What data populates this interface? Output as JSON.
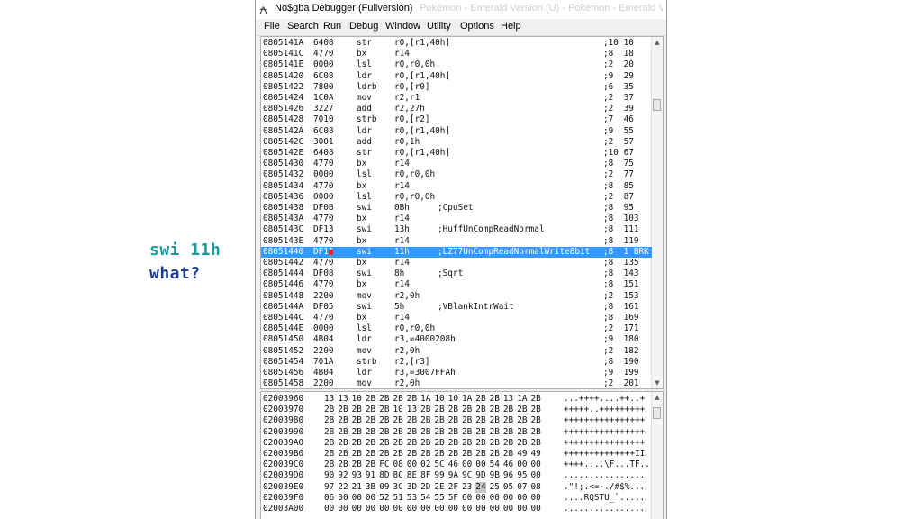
{
  "captions": {
    "line1": "swi 11h",
    "line2": "what?"
  },
  "window": {
    "title": "No$gba Debugger (Fullversion)",
    "ghost_title": "Pokémon - Emerald Version (U) - Pokémon - Emerald Version (U)",
    "app_icon": "nocash-icon"
  },
  "menu": [
    "File",
    "Search",
    "Run",
    "Debug",
    "Window",
    "Utility",
    "Options",
    "Help"
  ],
  "disasm_rows": [
    {
      "addr": "0805141A",
      "op": "6408",
      "mn": "str",
      "args": "r0,[r1,40h]",
      "cmt": "",
      "cyc": ";10 10"
    },
    {
      "addr": "0805141C",
      "op": "4770",
      "mn": "bx",
      "args": "r14",
      "cmt": "",
      "cyc": ";8  18"
    },
    {
      "addr": "0805141E",
      "op": "0000",
      "mn": "lsl",
      "args": "r0,r0,0h",
      "cmt": "",
      "cyc": ";2  20"
    },
    {
      "addr": "08051420",
      "op": "6C08",
      "mn": "ldr",
      "args": "r0,[r1,40h]",
      "cmt": "",
      "cyc": ";9  29"
    },
    {
      "addr": "08051422",
      "op": "7800",
      "mn": "ldrb",
      "args": "r0,[r0]",
      "cmt": "",
      "cyc": ";6  35"
    },
    {
      "addr": "08051424",
      "op": "1C0A",
      "mn": "mov",
      "args": "r2,r1",
      "cmt": "",
      "cyc": ";2  37"
    },
    {
      "addr": "08051426",
      "op": "3227",
      "mn": "add",
      "args": "r2,27h",
      "cmt": "",
      "cyc": ";2  39"
    },
    {
      "addr": "08051428",
      "op": "7010",
      "mn": "strb",
      "args": "r0,[r2]",
      "cmt": "",
      "cyc": ";7  46"
    },
    {
      "addr": "0805142A",
      "op": "6C08",
      "mn": "ldr",
      "args": "r0,[r1,40h]",
      "cmt": "",
      "cyc": ";9  55"
    },
    {
      "addr": "0805142C",
      "op": "3001",
      "mn": "add",
      "args": "r0,1h",
      "cmt": "",
      "cyc": ";2  57"
    },
    {
      "addr": "0805142E",
      "op": "6408",
      "mn": "str",
      "args": "r0,[r1,40h]",
      "cmt": "",
      "cyc": ";10 67"
    },
    {
      "addr": "08051430",
      "op": "4770",
      "mn": "bx",
      "args": "r14",
      "cmt": "",
      "cyc": ";8  75"
    },
    {
      "addr": "08051432",
      "op": "0000",
      "mn": "lsl",
      "args": "r0,r0,0h",
      "cmt": "",
      "cyc": ";2  77"
    },
    {
      "addr": "08051434",
      "op": "4770",
      "mn": "bx",
      "args": "r14",
      "cmt": "",
      "cyc": ";8  85"
    },
    {
      "addr": "08051436",
      "op": "0000",
      "mn": "lsl",
      "args": "r0,r0,0h",
      "cmt": "",
      "cyc": ";2  87"
    },
    {
      "addr": "08051438",
      "op": "DF0B",
      "mn": "swi",
      "args": "0Bh",
      "cmt": ";CpuSet",
      "cyc": ";8  95"
    },
    {
      "addr": "0805143A",
      "op": "4770",
      "mn": "bx",
      "args": "r14",
      "cmt": "",
      "cyc": ";8  103"
    },
    {
      "addr": "0805143C",
      "op": "DF13",
      "mn": "swi",
      "args": "13h",
      "cmt": ";HuffUnCompReadNormal",
      "cyc": ";8  111"
    },
    {
      "addr": "0805143E",
      "op": "4770",
      "mn": "bx",
      "args": "r14",
      "cmt": "",
      "cyc": ";8  119"
    },
    {
      "addr": "08051440",
      "op": "DF11",
      "mn": "swi",
      "args": "11h",
      "cmt": ";LZ77UnCompReadNormalWrite8bit",
      "cyc": ";8  1 BRK",
      "selected": true
    },
    {
      "addr": "08051442",
      "op": "4770",
      "mn": "bx",
      "args": "r14",
      "cmt": "",
      "cyc": ";8  135"
    },
    {
      "addr": "08051444",
      "op": "DF08",
      "mn": "swi",
      "args": "8h",
      "cmt": ";Sqrt",
      "cyc": ";8  143"
    },
    {
      "addr": "08051446",
      "op": "4770",
      "mn": "bx",
      "args": "r14",
      "cmt": "",
      "cyc": ";8  151"
    },
    {
      "addr": "08051448",
      "op": "2200",
      "mn": "mov",
      "args": "r2,0h",
      "cmt": "",
      "cyc": ";2  153"
    },
    {
      "addr": "0805144A",
      "op": "DF05",
      "mn": "swi",
      "args": "5h",
      "cmt": ";VBlankIntrWait",
      "cyc": ";8  161"
    },
    {
      "addr": "0805144C",
      "op": "4770",
      "mn": "bx",
      "args": "r14",
      "cmt": "",
      "cyc": ";8  169"
    },
    {
      "addr": "0805144E",
      "op": "0000",
      "mn": "lsl",
      "args": "r0,r0,0h",
      "cmt": "",
      "cyc": ";2  171"
    },
    {
      "addr": "08051450",
      "op": "4B04",
      "mn": "ldr",
      "args": "r3,=4000208h",
      "cmt": "",
      "cyc": ";9  180"
    },
    {
      "addr": "08051452",
      "op": "2200",
      "mn": "mov",
      "args": "r2,0h",
      "cmt": "",
      "cyc": ";2  182"
    },
    {
      "addr": "08051454",
      "op": "701A",
      "mn": "strb",
      "args": "r2,[r3]",
      "cmt": "",
      "cyc": ";8  190"
    },
    {
      "addr": "08051456",
      "op": "4B04",
      "mn": "ldr",
      "args": "r3,=3007FFAh",
      "cmt": "",
      "cyc": ";9  199"
    },
    {
      "addr": "08051458",
      "op": "2200",
      "mn": "mov",
      "args": "r2,0h",
      "cmt": "",
      "cyc": ";2  201"
    }
  ],
  "hex_rows": [
    {
      "addr": "02003960",
      "bytes": [
        "13",
        "13",
        "10",
        "2B",
        "2B",
        "2B",
        "2B",
        "1A",
        "10",
        "10",
        "1A",
        "2B",
        "2B",
        "13",
        "1A",
        "2B"
      ],
      "ascii": "...++++....++..+"
    },
    {
      "addr": "02003970",
      "bytes": [
        "2B",
        "2B",
        "2B",
        "2B",
        "2B",
        "10",
        "13",
        "2B",
        "2B",
        "2B",
        "2B",
        "2B",
        "2B",
        "2B",
        "2B",
        "2B"
      ],
      "ascii": "+++++..+++++++++"
    },
    {
      "addr": "02003980",
      "bytes": [
        "2B",
        "2B",
        "2B",
        "2B",
        "2B",
        "2B",
        "2B",
        "2B",
        "2B",
        "2B",
        "2B",
        "2B",
        "2B",
        "2B",
        "2B",
        "2B"
      ],
      "ascii": "++++++++++++++++"
    },
    {
      "addr": "02003990",
      "bytes": [
        "2B",
        "2B",
        "2B",
        "2B",
        "2B",
        "2B",
        "2B",
        "2B",
        "2B",
        "2B",
        "2B",
        "2B",
        "2B",
        "2B",
        "2B",
        "2B"
      ],
      "ascii": "++++++++++++++++"
    },
    {
      "addr": "020039A0",
      "bytes": [
        "2B",
        "2B",
        "2B",
        "2B",
        "2B",
        "2B",
        "2B",
        "2B",
        "2B",
        "2B",
        "2B",
        "2B",
        "2B",
        "2B",
        "2B",
        "2B"
      ],
      "ascii": "++++++++++++++++"
    },
    {
      "addr": "020039B0",
      "bytes": [
        "2B",
        "2B",
        "2B",
        "2B",
        "2B",
        "2B",
        "2B",
        "2B",
        "2B",
        "2B",
        "2B",
        "2B",
        "2B",
        "2B",
        "49",
        "49"
      ],
      "ascii": "++++++++++++++II"
    },
    {
      "addr": "020039C0",
      "bytes": [
        "2B",
        "2B",
        "2B",
        "2B",
        "FC",
        "08",
        "00",
        "02",
        "5C",
        "46",
        "00",
        "00",
        "54",
        "46",
        "00",
        "00"
      ],
      "ascii": "++++....\\F...TF.."
    },
    {
      "addr": "020039D0",
      "bytes": [
        "90",
        "92",
        "93",
        "91",
        "8D",
        "8C",
        "8E",
        "8F",
        "99",
        "9A",
        "9C",
        "9D",
        "9B",
        "96",
        "95",
        "00"
      ],
      "ascii": "................"
    },
    {
      "addr": "020039E0",
      "bytes": [
        "97",
        "22",
        "21",
        "3B",
        "09",
        "3C",
        "3D",
        "2D",
        "2E",
        "2F",
        "23",
        "24",
        "25",
        "05",
        "07",
        "08"
      ],
      "ascii": ".\"!;.<=-./#$%...",
      "highlight": 11
    },
    {
      "addr": "020039F0",
      "bytes": [
        "06",
        "00",
        "00",
        "00",
        "52",
        "51",
        "53",
        "54",
        "55",
        "5F",
        "60",
        "00",
        "00",
        "00",
        "00",
        "00"
      ],
      "ascii": "....RQSTU_`....."
    },
    {
      "addr": "02003A00",
      "bytes": [
        "00",
        "00",
        "00",
        "00",
        "00",
        "00",
        "00",
        "00",
        "00",
        "00",
        "00",
        "00",
        "00",
        "00",
        "00",
        "00"
      ],
      "ascii": "................"
    }
  ]
}
